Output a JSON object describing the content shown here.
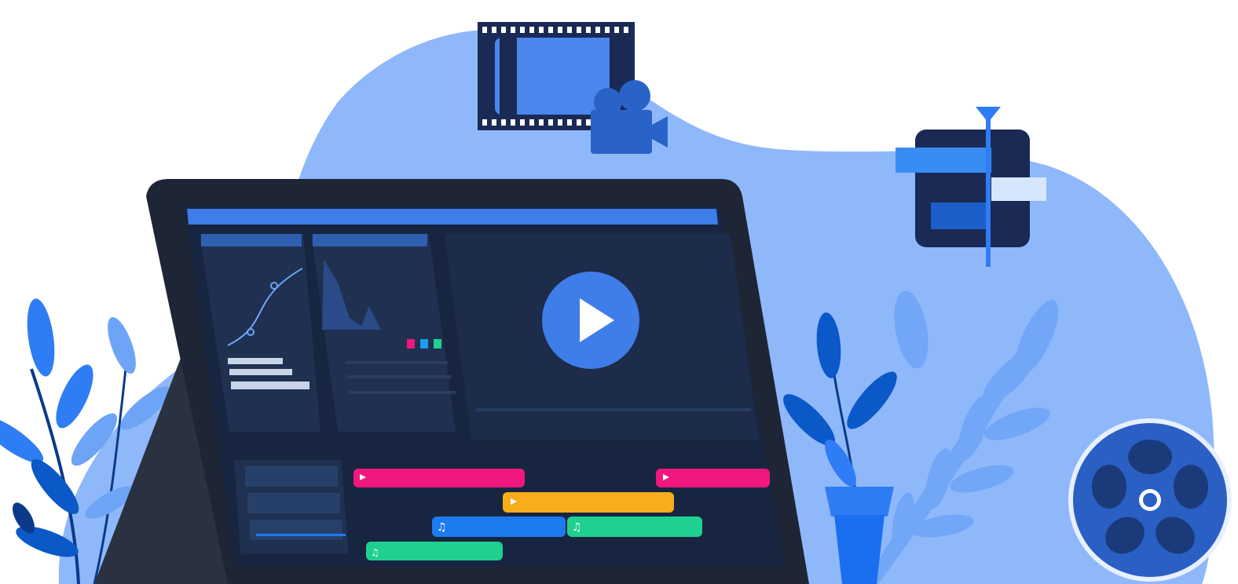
{
  "illustration": {
    "subject": "video-editing",
    "colors": {
      "blob": "#8fb8fb",
      "blob_light": "#a9c8fd",
      "device_frame": "#1e2535",
      "screen_bg": "#182540",
      "panel": "#1f3050",
      "accent_blue": "#3f7de8",
      "clip_pink": "#f0177e",
      "clip_orange": "#f8ad1c",
      "clip_blue": "#1d7bf0",
      "clip_green": "#1fd08e",
      "leaf_dark": "#0b58c8",
      "leaf_mid": "#2f7df4",
      "leaf_light": "#6ea4f6"
    },
    "icons": {
      "film_strip": "film-strip-icon",
      "camera": "video-camera-icon",
      "play": "play-icon",
      "trim_tool": "trim-cut-icon",
      "reel": "film-reel-icon",
      "audio_note": "music-note-icon",
      "clip_marker": "clip-flag-icon"
    },
    "timeline": {
      "track_count": 4,
      "clips": [
        {
          "type": "video",
          "color": "pink"
        },
        {
          "type": "video",
          "color": "pink"
        },
        {
          "type": "video",
          "color": "orange"
        },
        {
          "type": "audio",
          "color": "blue"
        },
        {
          "type": "audio",
          "color": "green"
        },
        {
          "type": "audio",
          "color": "green"
        }
      ]
    }
  }
}
